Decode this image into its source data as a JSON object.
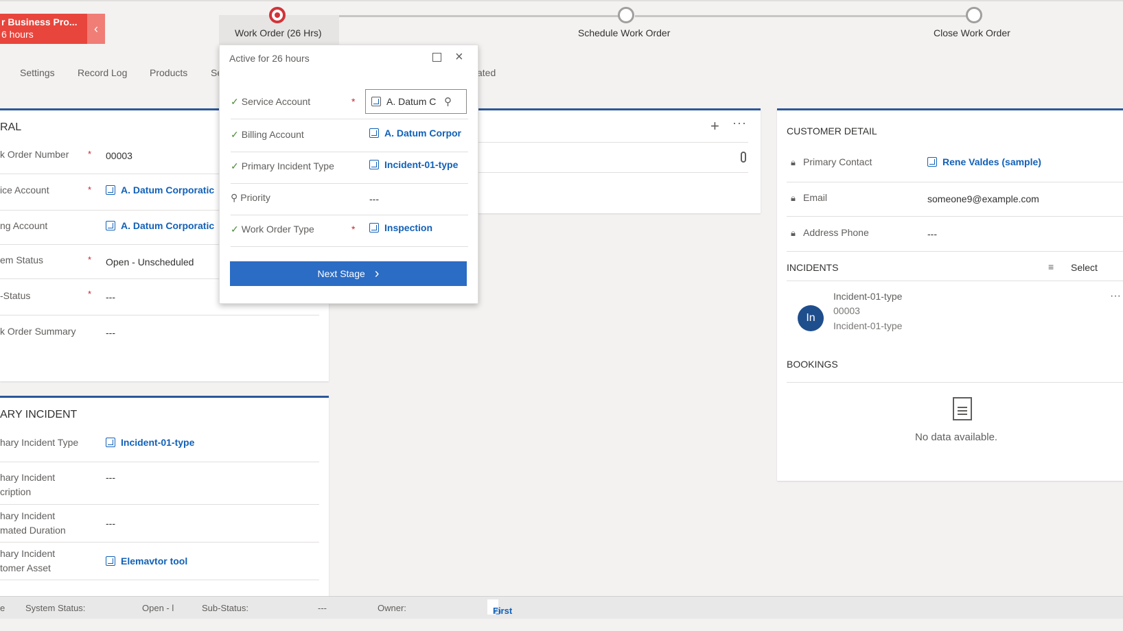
{
  "bpf": {
    "process_name": "r Business Pro...",
    "process_duration": "6 hours",
    "stages": [
      {
        "label": "Work Order  (26 Hrs)"
      },
      {
        "label": "Schedule Work Order"
      },
      {
        "label": "Close Work Order"
      }
    ],
    "flyout": {
      "title": "Active for 26 hours",
      "fields": [
        {
          "label": "Service Account",
          "value": "A. Datum C",
          "required": "*"
        },
        {
          "label": "Billing Account",
          "value": "A. Datum Corpor"
        },
        {
          "label": "Primary Incident Type",
          "value": "Incident-01-type"
        },
        {
          "label": "Priority",
          "value": "---"
        },
        {
          "label": "Work Order Type",
          "value": "Inspection",
          "required": "*"
        }
      ],
      "next_stage_label": "Next Stage"
    }
  },
  "tabs": [
    "Settings",
    "Record Log",
    "Products",
    "Se",
    "ated"
  ],
  "general": {
    "title": "RAL",
    "fields": [
      {
        "label": "k Order Number",
        "value": "00003",
        "required": "*"
      },
      {
        "label": "ice Account",
        "value": "A. Datum Corporatic",
        "required": "*"
      },
      {
        "label": "ng Account",
        "value": "A. Datum Corporatic"
      },
      {
        "label": "em Status",
        "value": "Open - Unscheduled",
        "required": "*"
      },
      {
        "label": "-Status",
        "value": "---",
        "required": "*"
      },
      {
        "label": "k Order Summary",
        "value": "---"
      }
    ]
  },
  "primary_incident": {
    "title": "ARY INCIDENT",
    "fields": [
      {
        "label": "hary Incident Type",
        "value": "Incident-01-type"
      },
      {
        "label1": "hary Incident",
        "label2": "cription",
        "value": "---"
      },
      {
        "label1": "hary Incident",
        "label2": "mated Duration",
        "value": "---"
      },
      {
        "label1": "hary Incident",
        "label2": "tomer Asset",
        "value": "Elemavtor tool"
      }
    ]
  },
  "customer_detail": {
    "title": "CUSTOMER DETAIL",
    "fields": [
      {
        "label": "Primary Contact",
        "value": "Rene Valdes (sample)"
      },
      {
        "label": "Email",
        "value": "someone9@example.com"
      },
      {
        "label": "Address Phone",
        "value": "---"
      }
    ]
  },
  "incidents": {
    "title": "INCIDENTS",
    "select_label": "Select",
    "item": {
      "avatar": "In",
      "line1": "Incident-01-type",
      "line2": "00003",
      "line3": "Incident-01-type"
    }
  },
  "bookings": {
    "title": "BOOKINGS",
    "empty_text": "No data available."
  },
  "footer": {
    "system_status_label": "System Status:",
    "system_status_value": "Open - l",
    "sub_status_label": "Sub-Status:",
    "sub_status_value": "---",
    "owner_label": "Owner:",
    "owner_value": "First"
  },
  "colors": {
    "accent_blue": "#1160b7",
    "bpf_red": "#e8453c",
    "primary_button": "#2b6cc4"
  }
}
